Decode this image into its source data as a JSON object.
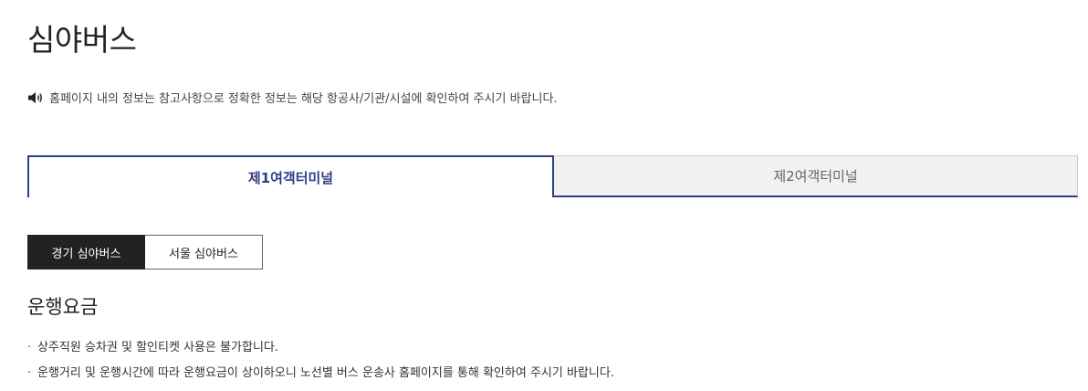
{
  "page": {
    "title": "심야버스"
  },
  "notice": {
    "icon": "speaker-icon",
    "text": "홈페이지 내의 정보는 참고사항으로 정확한 정보는 해당 항공사/기관/시설에 확인하여 주시기 바랍니다."
  },
  "terminal_tabs": [
    {
      "label": "제1여객터미널",
      "active": true
    },
    {
      "label": "제2여객터미널",
      "active": false
    }
  ],
  "region_tabs": [
    {
      "label": "경기 심야버스",
      "active": true
    },
    {
      "label": "서울 심야버스",
      "active": false
    }
  ],
  "fare_section": {
    "title": "운행요금",
    "bullet": "·",
    "items": [
      "상주직원 승차권 및 할인티켓 사용은 불가합니다.",
      "운행거리 및 운행시간에 따라 운행요금이 상이하오니 노선별 버스 운송사 홈페이지를 통해 확인하여 주시기 바랍니다."
    ]
  },
  "colors": {
    "accent": "#2f3d87",
    "dark_tab": "#222222",
    "inactive_tab_bg": "#f1f1f1"
  }
}
